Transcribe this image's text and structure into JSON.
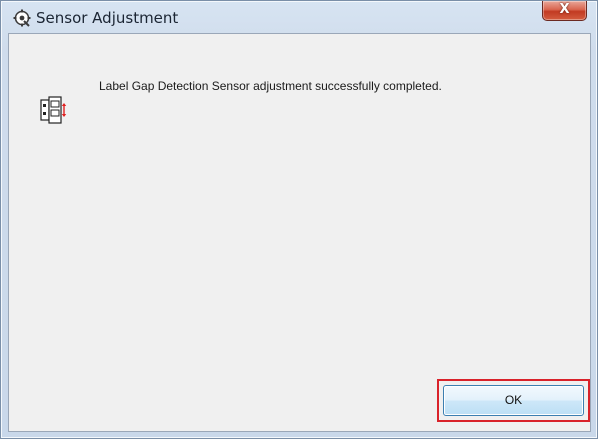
{
  "window": {
    "title": "Sensor Adjustment",
    "close_glyph": "X",
    "title_icon": "sensor-settings-icon"
  },
  "dialog": {
    "message": "Label Gap Detection Sensor adjustment successfully completed.",
    "message_icon": "label-gap-sensor-icon",
    "ok_label": "OK"
  },
  "colors": {
    "highlight": "#d9222a",
    "close_button": "#c23a22",
    "button_border": "#3c7fb1"
  }
}
